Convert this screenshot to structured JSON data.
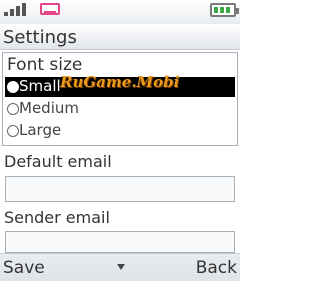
{
  "status_bar": {
    "signal_icon": "signal-strength-icon",
    "message_icon": "message-envelope-icon",
    "battery_icon": "battery-icon",
    "battery_level": 0.75
  },
  "title": "Settings",
  "font_size": {
    "label": "Font size",
    "options": [
      {
        "label": "Small",
        "selected": true
      },
      {
        "label": "Medium",
        "selected": false
      },
      {
        "label": "Large",
        "selected": false
      }
    ]
  },
  "default_email": {
    "label": "Default email",
    "value": ""
  },
  "sender_email": {
    "label": "Sender email",
    "value": ""
  },
  "watermark": "RuGame.Mobi",
  "softkeys": {
    "left": "Save",
    "right": "Back"
  },
  "colors": {
    "selection": "#000000",
    "watermark": "#e99a1a",
    "message_icon": "#e8448a",
    "battery": "#3aa845"
  }
}
